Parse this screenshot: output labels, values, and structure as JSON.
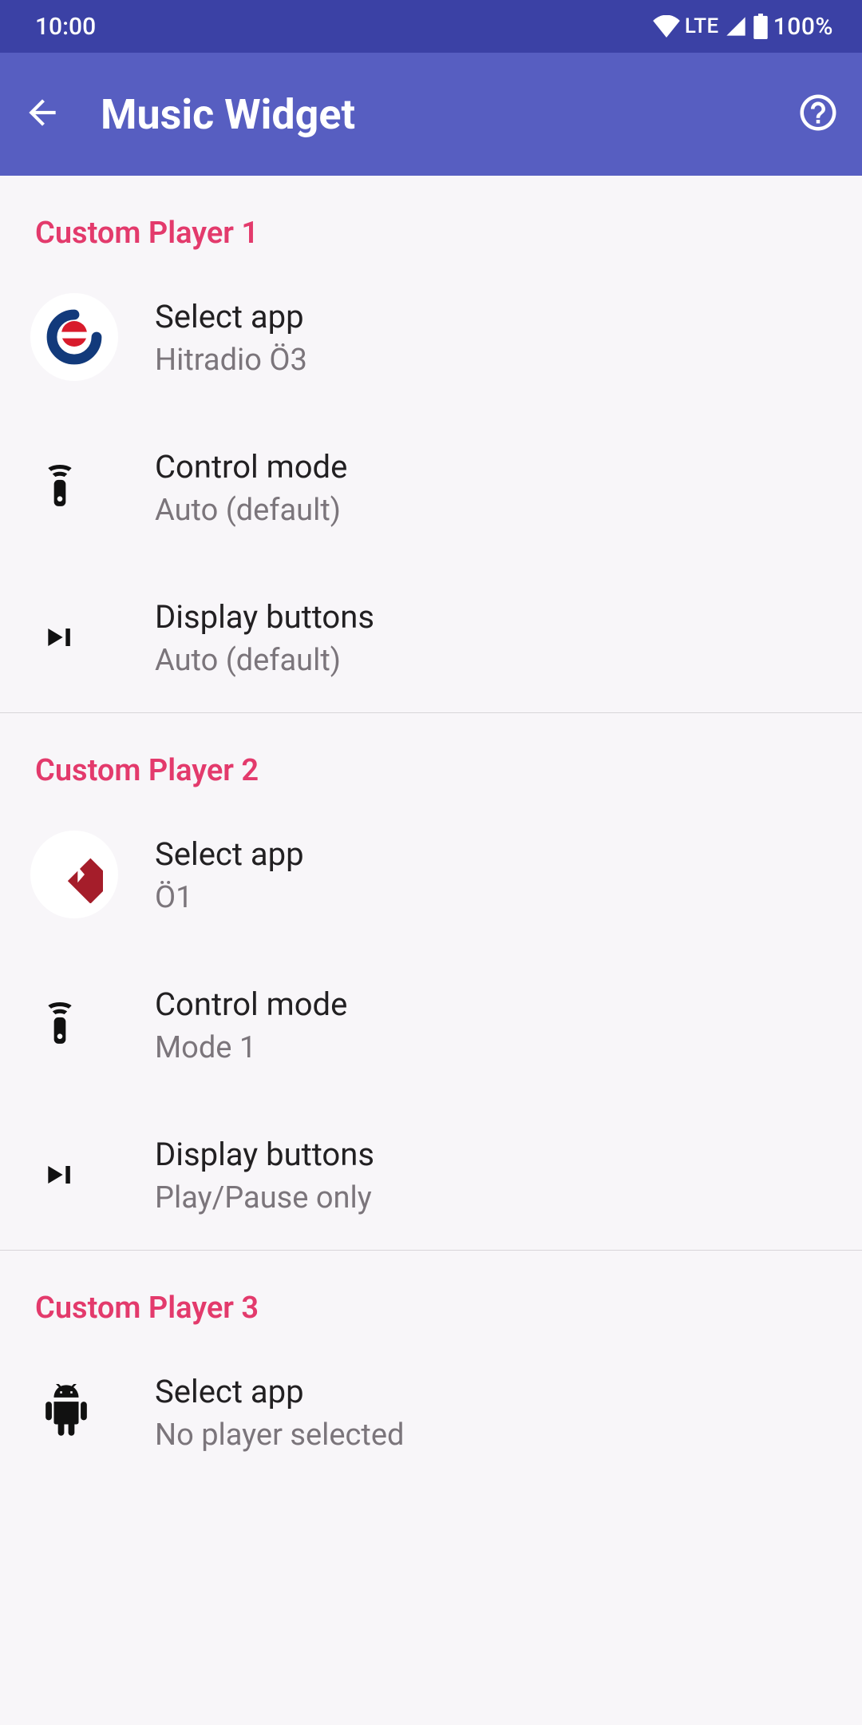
{
  "status": {
    "time": "10:00",
    "network": "LTE",
    "battery": "100%"
  },
  "appbar": {
    "title": "Music Widget"
  },
  "sections": [
    {
      "header": "Custom Player 1",
      "select": {
        "title": "Select app",
        "subtitle": "Hitradio Ö3"
      },
      "control": {
        "title": "Control mode",
        "subtitle": "Auto (default)"
      },
      "display": {
        "title": "Display buttons",
        "subtitle": "Auto (default)"
      }
    },
    {
      "header": "Custom Player 2",
      "select": {
        "title": "Select app",
        "subtitle": "Ö1"
      },
      "control": {
        "title": "Control mode",
        "subtitle": "Mode 1"
      },
      "display": {
        "title": "Display buttons",
        "subtitle": "Play/Pause only"
      }
    },
    {
      "header": "Custom Player 3",
      "select": {
        "title": "Select app",
        "subtitle": "No player selected"
      }
    }
  ]
}
